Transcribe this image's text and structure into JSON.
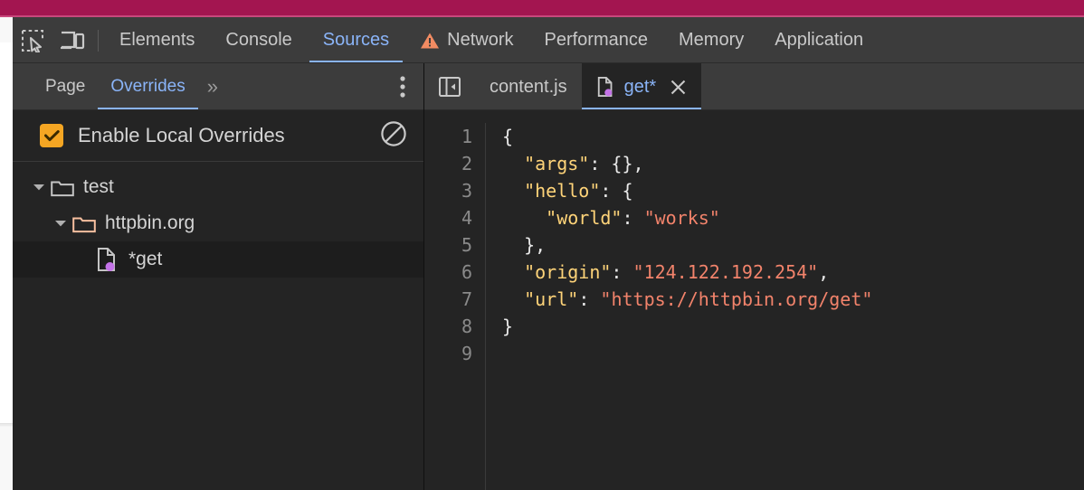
{
  "browser": {
    "header_color": "#a31550"
  },
  "devtools": {
    "accent": "#8ab4f8",
    "toolbar": {
      "inspect_icon": "inspect-element-icon",
      "device_icon": "device-toolbar-icon"
    },
    "main_tabs": [
      {
        "label": "Elements",
        "active": false,
        "warning": false
      },
      {
        "label": "Console",
        "active": false,
        "warning": false
      },
      {
        "label": "Sources",
        "active": true,
        "warning": false
      },
      {
        "label": "Network",
        "active": false,
        "warning": true
      },
      {
        "label": "Performance",
        "active": false,
        "warning": false
      },
      {
        "label": "Memory",
        "active": false,
        "warning": false
      },
      {
        "label": "Application",
        "active": false,
        "warning": false
      }
    ],
    "navigator": {
      "tabs": [
        {
          "label": "Page",
          "active": false
        },
        {
          "label": "Overrides",
          "active": true
        }
      ],
      "overflow_label": "»",
      "more_options_icon": "kebab-menu-icon",
      "overrides": {
        "checkbox_checked": true,
        "checkbox_color": "#f5a623",
        "label": "Enable Local Overrides",
        "clear_icon": "no-entry-icon"
      },
      "tree": [
        {
          "label": "test",
          "depth": 0,
          "type": "folder",
          "expanded": true,
          "selected": false,
          "folder_color": "#c4c4c4"
        },
        {
          "label": "httpbin.org",
          "depth": 1,
          "type": "folder",
          "expanded": true,
          "selected": false,
          "folder_color": "#f8c0a0"
        },
        {
          "label": "*get",
          "depth": 2,
          "type": "file",
          "expanded": false,
          "selected": true,
          "badge_color": "#c473e8"
        }
      ]
    },
    "editor": {
      "panel_toggle_icon": "show-navigator-icon",
      "tabs": [
        {
          "label": "content.js",
          "active": false,
          "has_badge": false,
          "closable": false
        },
        {
          "label": "get*",
          "active": true,
          "has_badge": true,
          "closable": true,
          "close_icon": "close-icon"
        }
      ],
      "line_numbers": [
        "1",
        "2",
        "3",
        "4",
        "5",
        "6",
        "7",
        "8",
        "9"
      ],
      "lines": [
        [
          {
            "t": "{",
            "c": "p"
          }
        ],
        [
          {
            "t": "  ",
            "c": "p"
          },
          {
            "t": "\"args\"",
            "c": "k"
          },
          {
            "t": ": {},",
            "c": "p"
          }
        ],
        [
          {
            "t": "  ",
            "c": "p"
          },
          {
            "t": "\"hello\"",
            "c": "k"
          },
          {
            "t": ": {",
            "c": "p"
          }
        ],
        [
          {
            "t": "    ",
            "c": "p"
          },
          {
            "t": "\"world\"",
            "c": "k"
          },
          {
            "t": ": ",
            "c": "p"
          },
          {
            "t": "\"works\"",
            "c": "s"
          }
        ],
        [
          {
            "t": "  },",
            "c": "p"
          }
        ],
        [
          {
            "t": "  ",
            "c": "p"
          },
          {
            "t": "\"origin\"",
            "c": "k"
          },
          {
            "t": ": ",
            "c": "p"
          },
          {
            "t": "\"124.122.192.254\"",
            "c": "s"
          },
          {
            "t": ",",
            "c": "p"
          }
        ],
        [
          {
            "t": "  ",
            "c": "p"
          },
          {
            "t": "\"url\"",
            "c": "k"
          },
          {
            "t": ": ",
            "c": "p"
          },
          {
            "t": "\"https://httpbin.org/get\"",
            "c": "s"
          }
        ],
        [
          {
            "t": "}",
            "c": "p"
          }
        ],
        [
          {
            "t": "",
            "c": "p"
          }
        ]
      ]
    }
  }
}
